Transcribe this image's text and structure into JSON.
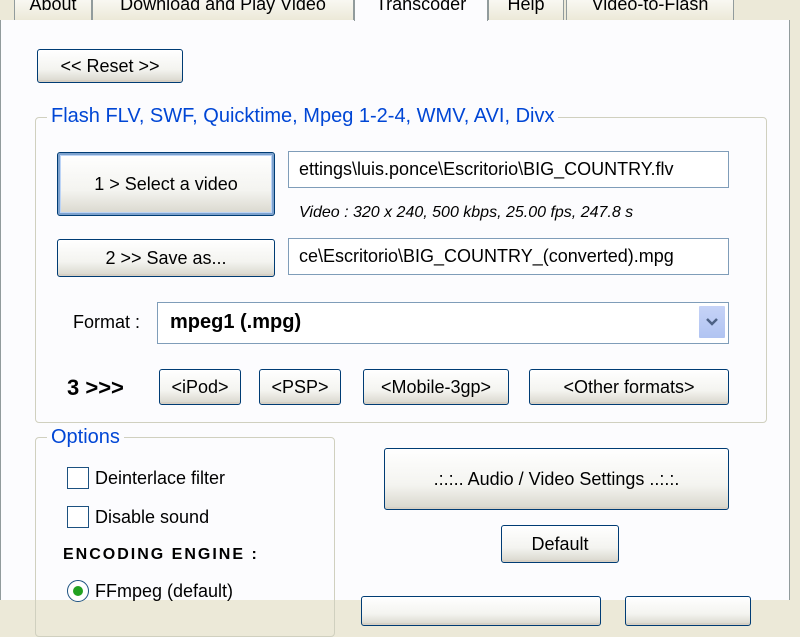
{
  "tabs": [
    {
      "label": "About"
    },
    {
      "label": "Download and Play Video"
    },
    {
      "label": "Transcoder"
    },
    {
      "label": "Help"
    },
    {
      "label": "Video-to-Flash"
    }
  ],
  "reset_label": "<<  Reset  >>",
  "formats_group": {
    "legend": "Flash FLV, SWF, Quicktime, Mpeg 1-2-4, WMV, AVI, Divx",
    "select_video_label": "1 > Select a video",
    "input_path": "ettings\\luis.ponce\\Escritorio\\BIG_COUNTRY.flv",
    "video_info": "Video  :  320 x 240,  500 kbps,  25.00 fps,  247.8 s",
    "save_as_label": "2 >> Save as...",
    "output_path": "ce\\Escritorio\\BIG_COUNTRY_(converted).mpg",
    "format_label": "Format :",
    "format_value": "mpeg1 (.mpg)",
    "step3_label": "3 >>>",
    "presets": [
      "<iPod>",
      "<PSP>",
      "<Mobile-3gp>",
      "<Other formats>"
    ]
  },
  "options_group": {
    "legend": "Options",
    "deinterlace_label": "Deinterlace filter",
    "deinterlace_checked": false,
    "disable_sound_label": "Disable sound",
    "disable_sound_checked": false,
    "engine_heading": "ENCODING ENGINE :",
    "engine_option": "FFmpeg (default)",
    "engine_selected": true
  },
  "av_settings_label": ".:.:..  Audio / Video Settings  ..:.:.",
  "default_label": "Default",
  "colors": {
    "accent": "#0046d5",
    "tab_highlight": "#ffc83c",
    "border": "#003c74"
  },
  "icons": {
    "combo_arrow": "chevron-down-icon"
  }
}
